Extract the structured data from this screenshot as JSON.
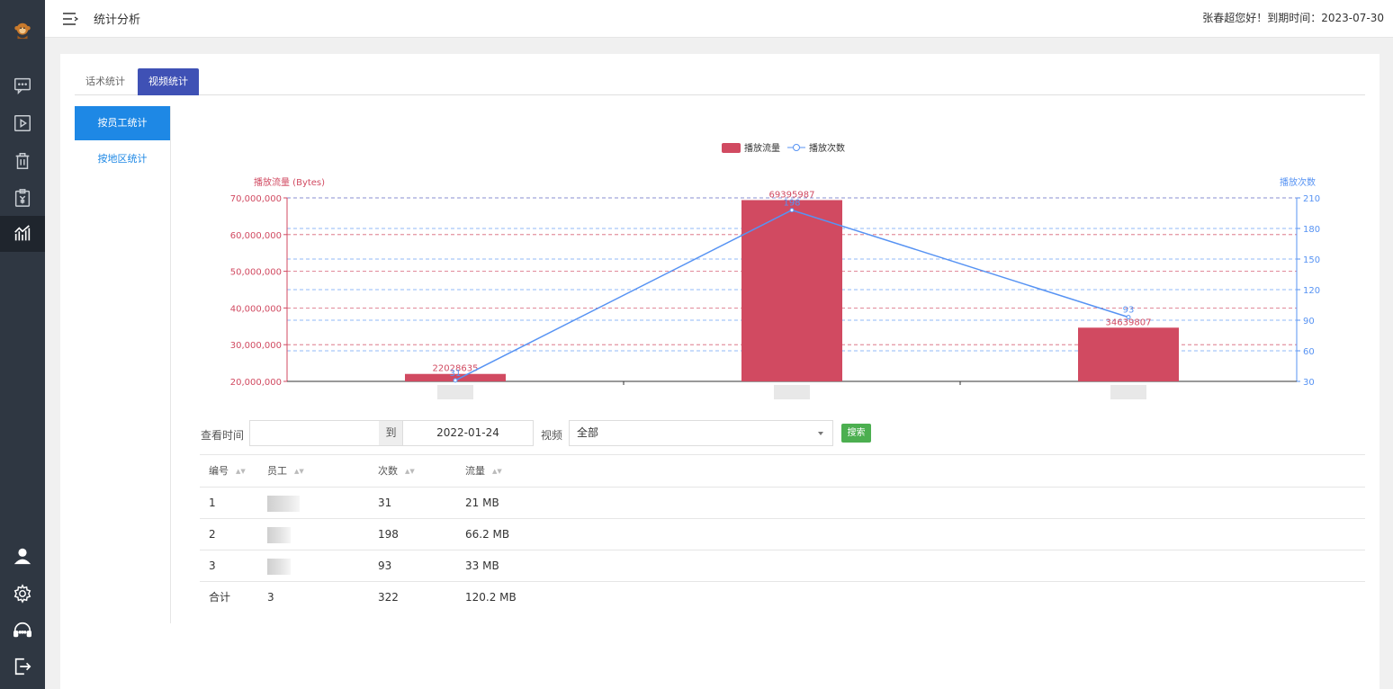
{
  "topbar": {
    "title": "统计分析",
    "greeting": "张春超您好！到期时间：2023-07-30"
  },
  "sidebar": {
    "items": [
      {
        "icon": "avatar-monkey-icon"
      },
      {
        "icon": "message-icon"
      },
      {
        "icon": "video-play-icon"
      },
      {
        "icon": "trash-icon"
      },
      {
        "icon": "yen-clipboard-icon"
      },
      {
        "icon": "analytics-chart-icon",
        "active": true
      },
      {
        "icon": "user-icon"
      },
      {
        "icon": "settings-gear-icon"
      },
      {
        "icon": "support-headset-icon"
      },
      {
        "icon": "logout-icon"
      }
    ]
  },
  "tabs": [
    {
      "label": "话术统计",
      "active": false
    },
    {
      "label": "视频统计",
      "active": true
    }
  ],
  "subnav": [
    {
      "label": "按员工统计",
      "active": true
    },
    {
      "label": "按地区统计",
      "active": false
    }
  ],
  "colors": {
    "bar": "#d14a61",
    "line": "#5793f3",
    "accent": "#3f51b5",
    "primary": "#1e88e5",
    "search": "#4caf50"
  },
  "chart_data": {
    "type": "bar",
    "categories": [
      "",
      "",
      ""
    ],
    "series": [
      {
        "name": "播放流量",
        "type": "bar",
        "axis": "left",
        "values": [
          22028635,
          69395987,
          34639807
        ]
      },
      {
        "name": "播放次数",
        "type": "line",
        "axis": "right",
        "values": [
          31,
          198,
          93
        ]
      }
    ],
    "ylabel_left": "播放流量 (Bytes)",
    "ylabel_right": "播放次数",
    "ylim_left": [
      20000000,
      70000000
    ],
    "ylim_right": [
      30,
      210
    ],
    "yticks_left": [
      "70,000,000",
      "60,000,000",
      "50,000,000",
      "40,000,000",
      "30,000,000",
      "20,000,000"
    ],
    "yticks_right": [
      "210",
      "180",
      "150",
      "120",
      "90",
      "60",
      "30"
    ],
    "legend_position": "top-center",
    "grid": true
  },
  "filter": {
    "time_label": "查看时间",
    "start_date": "",
    "to_label": "到",
    "end_date": "2022-01-24",
    "video_label": "视频",
    "video_value": "全部",
    "search_label": "搜索"
  },
  "table": {
    "columns": [
      "编号",
      "员工",
      "次数",
      "流量"
    ],
    "rows": [
      {
        "id": "1",
        "count": "31",
        "traffic": "21 MB"
      },
      {
        "id": "2",
        "count": "198",
        "traffic": "66.2 MB"
      },
      {
        "id": "3",
        "count": "93",
        "traffic": "33 MB"
      }
    ],
    "footer": {
      "label": "合计",
      "employees": "3",
      "count": "322",
      "traffic": "120.2 MB"
    }
  }
}
